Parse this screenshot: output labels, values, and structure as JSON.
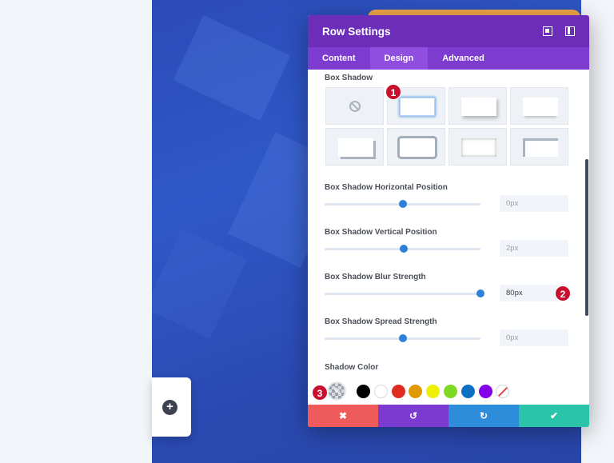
{
  "modal": {
    "title": "Row Settings",
    "tabs": [
      "Content",
      "Design",
      "Advanced"
    ],
    "active_tab": "Design"
  },
  "box_shadow": {
    "label": "Box Shadow",
    "presets": [
      "none",
      "preset-1",
      "preset-2",
      "preset-3",
      "preset-4",
      "preset-5",
      "preset-6",
      "preset-7"
    ],
    "selected": "preset-1"
  },
  "fields": [
    {
      "label": "Box Shadow Horizontal Position",
      "value": "0px",
      "slider_fraction": 0.5,
      "filled": false
    },
    {
      "label": "Box Shadow Vertical Position",
      "value": "2px",
      "slider_fraction": 0.51,
      "filled": false
    },
    {
      "label": "Box Shadow Blur Strength",
      "value": "80px",
      "slider_fraction": 1.0,
      "filled": true
    },
    {
      "label": "Box Shadow Spread Strength",
      "value": "0px",
      "slider_fraction": 0.5,
      "filled": false
    }
  ],
  "shadow_color": {
    "label": "Shadow Color",
    "picker_icon": "eyedropper-icon",
    "swatches": [
      "#000000",
      "#ffffff",
      "#e02b20",
      "#e09900",
      "#edf000",
      "#7cda24",
      "#0c71c3",
      "#8300e9"
    ],
    "no_color_icon": "no-color-icon"
  },
  "footer": {
    "buttons": [
      {
        "name": "cancel",
        "icon": "close-icon",
        "glyph": "✖",
        "color": "#ef5a5a"
      },
      {
        "name": "undo",
        "icon": "undo-icon",
        "glyph": "↺",
        "color": "#7b3ad0"
      },
      {
        "name": "redo",
        "icon": "redo-icon",
        "glyph": "↻",
        "color": "#2d8ddb"
      },
      {
        "name": "save",
        "icon": "check-icon",
        "glyph": "✔",
        "color": "#29c4a9"
      }
    ]
  },
  "annotations": [
    "1",
    "2",
    "3"
  ],
  "add_button_glyph": "+"
}
